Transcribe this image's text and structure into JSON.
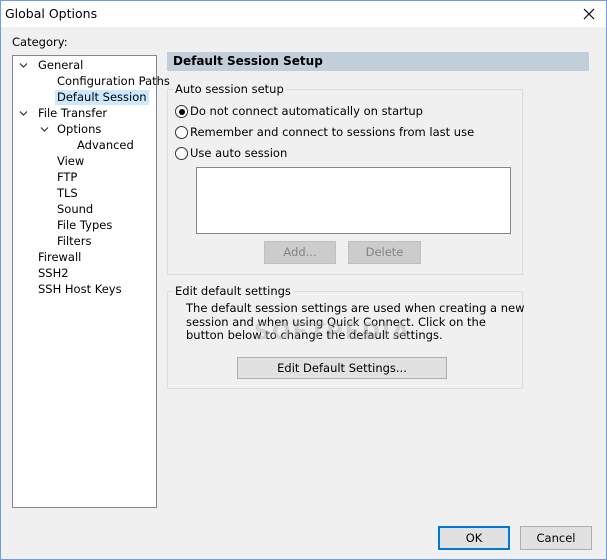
{
  "window": {
    "title": "Global Options"
  },
  "category_label": "Category:",
  "tree": {
    "general": "General",
    "configuration_paths": "Configuration Paths",
    "default_session": "Default Session",
    "file_transfer": "File Transfer",
    "options": "Options",
    "advanced": "Advanced",
    "view": "View",
    "ftp": "FTP",
    "tls": "TLS",
    "sound": "Sound",
    "file_types": "File Types",
    "filters": "Filters",
    "firewall": "Firewall",
    "ssh2": "SSH2",
    "ssh_host_keys": "SSH Host Keys"
  },
  "panel": {
    "title": "Default Session Setup",
    "auto_session": {
      "legend": "Auto session setup",
      "radio_no_connect": "Do not connect automatically on startup",
      "radio_remember": "Remember and connect to sessions from last use",
      "radio_auto": "Use auto session",
      "selected": "radio_no_connect",
      "add_label": "Add...",
      "delete_label": "Delete"
    },
    "edit_default": {
      "legend": "Edit default settings",
      "line1": "The default session settings are used when creating a new",
      "line2": "session and when using Quick Connect.  Click on the",
      "line3": "button below to change the default settings.",
      "button_label": "Edit Default Settings..."
    }
  },
  "watermark": "SOFTPEDIA",
  "footer": {
    "ok_label": "OK",
    "cancel_label": "Cancel"
  },
  "colors": {
    "selection": "#cce8ff",
    "panel_header": "#c3cedb",
    "focus_border": "#0078d7"
  }
}
